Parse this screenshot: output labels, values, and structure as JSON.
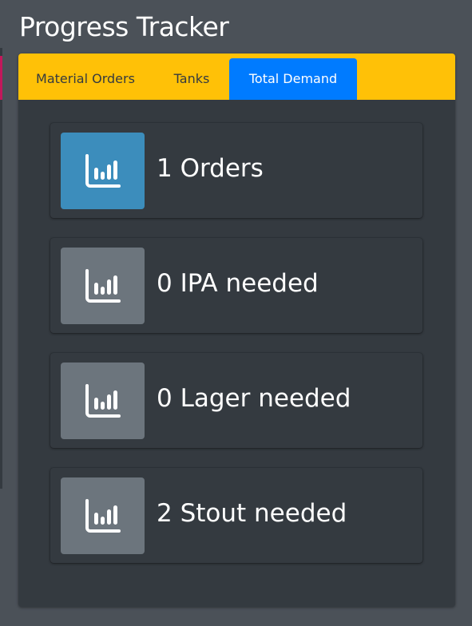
{
  "page_title": "Progress Tracker",
  "tabs": [
    {
      "label": "Material Orders"
    },
    {
      "label": "Tanks"
    },
    {
      "label": "Total Demand",
      "active": true
    }
  ],
  "info_boxes": [
    {
      "text": "1 Orders",
      "icon": "bar-chart-icon",
      "color": "#3c8dbc"
    },
    {
      "text": "0 IPA needed",
      "icon": "bar-chart-icon",
      "color": "#6c757d"
    },
    {
      "text": "0 Lager needed",
      "icon": "bar-chart-icon",
      "color": "#6c757d"
    },
    {
      "text": "2 Stout needed",
      "icon": "bar-chart-icon",
      "color": "#6c757d"
    }
  ],
  "colors": {
    "background": "#4b5158",
    "card": "#343a40",
    "header": "#ffc107",
    "active_tab": "#007bff"
  }
}
